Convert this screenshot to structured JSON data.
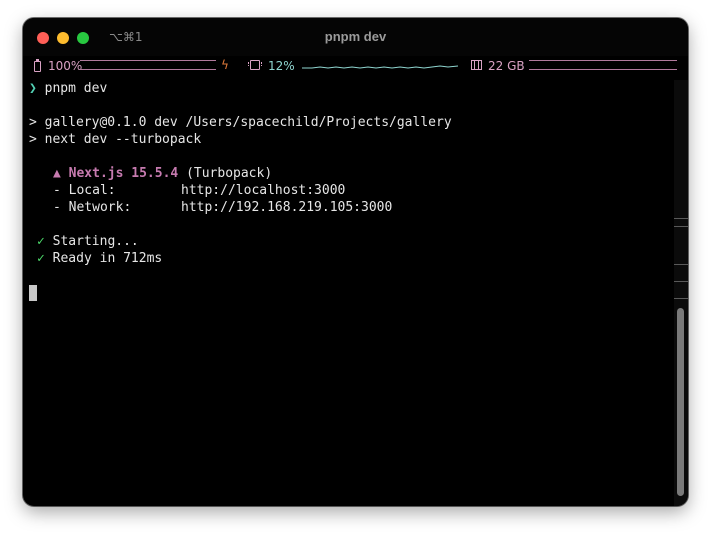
{
  "window": {
    "title": "pnpm dev",
    "shortcut": "⌥⌘1"
  },
  "statusbar": {
    "battery": {
      "label": "100%",
      "level_percent": 100,
      "charging": true
    },
    "cpu": {
      "label": "12%",
      "usage_percent": 12
    },
    "memory": {
      "label": "22 GB"
    }
  },
  "terminal": {
    "prompt_symbol": "❯",
    "command": "pnpm dev",
    "script_line": "> gallery@0.1.0 dev /Users/spacechild/Projects/gallery",
    "script_cmd": "> next dev --turbopack",
    "next_marker": "▲",
    "next_version": "Next.js 15.5.4",
    "next_mode": "(Turbopack)",
    "local_label": "- Local:",
    "local_url": "http://localhost:3000",
    "network_label": "- Network:",
    "network_url": "http://192.168.219.105:3000",
    "check": "✓",
    "starting": "Starting...",
    "ready": "Ready in 712ms"
  },
  "colors": {
    "prompt": "#52d1b4",
    "next_brand": "#c77bb0",
    "check": "#4cd86a",
    "status_text": "#d9a2c4",
    "cpu_text": "#8fd6d0",
    "bolt": "#e07a3a"
  },
  "icons": {
    "battery": "battery-icon",
    "charging": "bolt-icon",
    "cpu": "cpu-chip-icon",
    "memory": "memory-icon"
  }
}
